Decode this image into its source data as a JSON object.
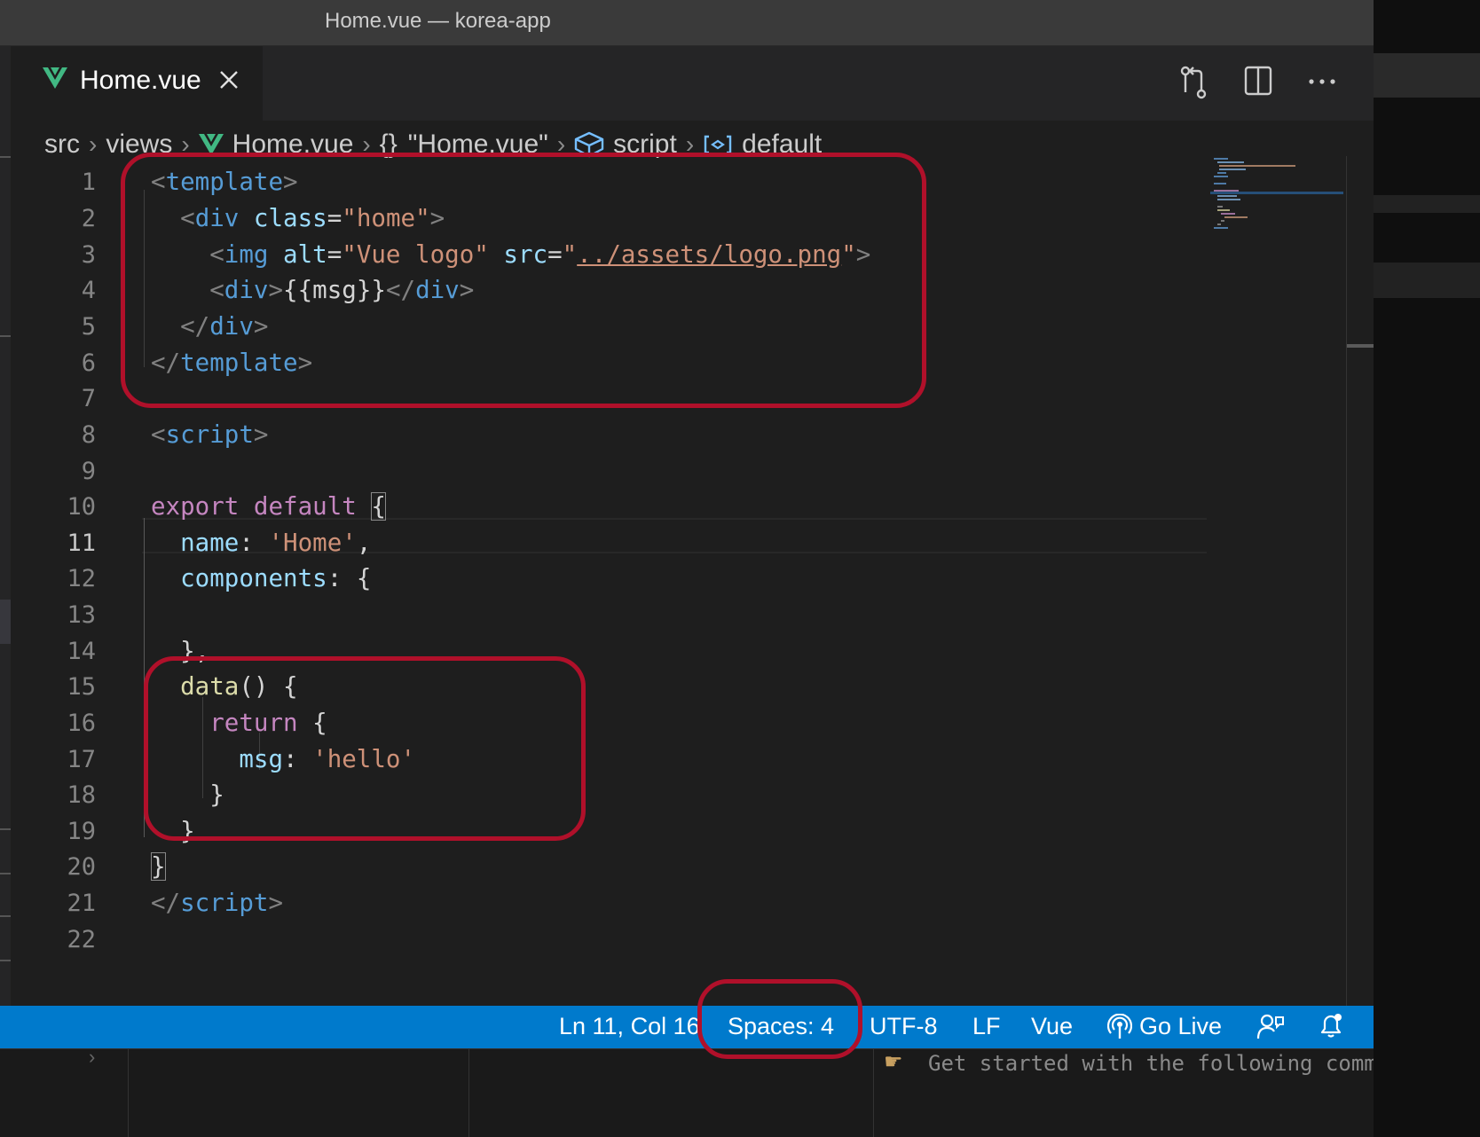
{
  "window": {
    "title": "Home.vue — korea-app"
  },
  "tab": {
    "label": "Home.vue",
    "icon": "vue-logo-icon"
  },
  "tab_actions": [
    {
      "name": "open-changes-icon"
    },
    {
      "name": "split-editor-icon"
    },
    {
      "name": "more-actions-icon"
    }
  ],
  "breadcrumb": {
    "items": [
      {
        "label": "src",
        "icon": ""
      },
      {
        "label": "views",
        "icon": ""
      },
      {
        "label": "Home.vue",
        "icon": "vue-logo-icon"
      },
      {
        "label": "\"Home.vue\"",
        "icon": "braces-icon",
        "icon_text": "{}"
      },
      {
        "label": "script",
        "icon": "module-cube-icon"
      },
      {
        "label": "default",
        "icon": "variable-icon"
      }
    ]
  },
  "editor": {
    "current_line": 11,
    "lines": [
      {
        "n": "1",
        "tokens": [
          [
            "punc",
            "<"
          ],
          [
            "tag",
            "template"
          ],
          [
            "punc",
            ">"
          ]
        ]
      },
      {
        "n": "2",
        "tokens": [
          [
            "txt",
            "  "
          ],
          [
            "punc",
            "<"
          ],
          [
            "tag",
            "div"
          ],
          [
            "txt",
            " "
          ],
          [
            "attr",
            "class"
          ],
          [
            "txt",
            "="
          ],
          [
            "str",
            "\"home\""
          ],
          [
            "punc",
            ">"
          ]
        ]
      },
      {
        "n": "3",
        "tokens": [
          [
            "txt",
            "    "
          ],
          [
            "punc",
            "<"
          ],
          [
            "tag",
            "img"
          ],
          [
            "txt",
            " "
          ],
          [
            "attr",
            "alt"
          ],
          [
            "txt",
            "="
          ],
          [
            "str",
            "\"Vue logo\""
          ],
          [
            "txt",
            " "
          ],
          [
            "attr",
            "src"
          ],
          [
            "txt",
            "="
          ],
          [
            "str",
            "\""
          ],
          [
            "link",
            "../assets/logo.png"
          ],
          [
            "str",
            "\""
          ],
          [
            "punc",
            ">"
          ]
        ]
      },
      {
        "n": "4",
        "tokens": [
          [
            "txt",
            "    "
          ],
          [
            "punc",
            "<"
          ],
          [
            "tag",
            "div"
          ],
          [
            "punc",
            ">"
          ],
          [
            "txt",
            "{{msg}}"
          ],
          [
            "punc",
            "</"
          ],
          [
            "tag",
            "div"
          ],
          [
            "punc",
            ">"
          ]
        ]
      },
      {
        "n": "5",
        "tokens": [
          [
            "txt",
            "  "
          ],
          [
            "punc",
            "</"
          ],
          [
            "tag",
            "div"
          ],
          [
            "punc",
            ">"
          ]
        ]
      },
      {
        "n": "6",
        "tokens": [
          [
            "punc",
            "</"
          ],
          [
            "tag",
            "template"
          ],
          [
            "punc",
            ">"
          ]
        ]
      },
      {
        "n": "7",
        "tokens": []
      },
      {
        "n": "8",
        "tokens": [
          [
            "punc",
            "<"
          ],
          [
            "tag",
            "script"
          ],
          [
            "punc",
            ">"
          ]
        ]
      },
      {
        "n": "9",
        "tokens": []
      },
      {
        "n": "10",
        "tokens": [
          [
            "kw",
            "export"
          ],
          [
            "txt",
            " "
          ],
          [
            "kw",
            "default"
          ],
          [
            "txt",
            " "
          ],
          [
            "brk",
            "{"
          ]
        ]
      },
      {
        "n": "11",
        "tokens": [
          [
            "txt",
            "  "
          ],
          [
            "prop",
            "name"
          ],
          [
            "txt",
            ": "
          ],
          [
            "str",
            "'Home'"
          ],
          [
            "txt",
            ","
          ]
        ]
      },
      {
        "n": "12",
        "tokens": [
          [
            "txt",
            "  "
          ],
          [
            "prop",
            "components"
          ],
          [
            "txt",
            ": {"
          ]
        ]
      },
      {
        "n": "13",
        "tokens": []
      },
      {
        "n": "14",
        "tokens": [
          [
            "txt",
            "  },"
          ]
        ]
      },
      {
        "n": "15",
        "tokens": [
          [
            "txt",
            "  "
          ],
          [
            "fn",
            "data"
          ],
          [
            "txt",
            "() {"
          ]
        ]
      },
      {
        "n": "16",
        "tokens": [
          [
            "txt",
            "    "
          ],
          [
            "kw",
            "return"
          ],
          [
            "txt",
            " {"
          ]
        ]
      },
      {
        "n": "17",
        "tokens": [
          [
            "txt",
            "      "
          ],
          [
            "prop",
            "msg"
          ],
          [
            "txt",
            ": "
          ],
          [
            "str",
            "'hello'"
          ]
        ]
      },
      {
        "n": "18",
        "tokens": [
          [
            "txt",
            "    }"
          ]
        ]
      },
      {
        "n": "19",
        "tokens": [
          [
            "txt",
            "  }"
          ]
        ]
      },
      {
        "n": "20",
        "tokens": [
          [
            "brk",
            "}"
          ]
        ]
      },
      {
        "n": "21",
        "tokens": [
          [
            "punc",
            "</"
          ],
          [
            "tag",
            "script"
          ],
          [
            "punc",
            ">"
          ]
        ]
      },
      {
        "n": "22",
        "tokens": []
      }
    ]
  },
  "statusbar": {
    "position": "Ln 11, Col 16",
    "indent": "Spaces: 4",
    "encoding": "UTF-8",
    "eol": "LF",
    "language": "Vue",
    "go_live": "Go Live"
  },
  "terminal": {
    "text": "Get started with the following commands:"
  },
  "colors": {
    "statusbar": "#007acc",
    "highlight_box": "#b0102a",
    "editor_bg": "#1e1e1e"
  }
}
